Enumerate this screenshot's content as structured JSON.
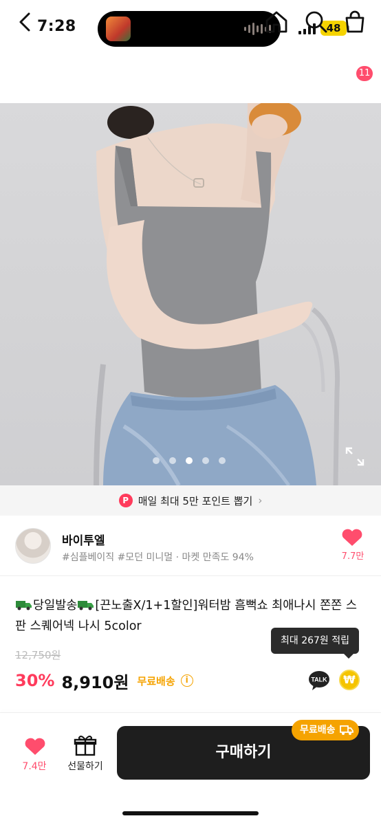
{
  "status_bar": {
    "time": "7:28",
    "battery": "48"
  },
  "nav": {
    "cart_count": "11"
  },
  "hero": {
    "slide_count": 5,
    "active_slide": 3
  },
  "points_banner": {
    "badge": "P",
    "text": "매일 최대 5만 포인트 뽑기",
    "chevron": "›"
  },
  "seller": {
    "name": "바이투엘",
    "tags": "#심플베이직 #모던 미니멀 · 마켓 만족도 94%",
    "like_count": "7.7만"
  },
  "product": {
    "title_part1": "당일발송",
    "title_part2": "[끈노출X/1+1할인]워터밤 흠뻑쇼 최애나시 쫀쫀 스판 스퀘어넥 나시 5color",
    "tooltip": "최대 267원 적립",
    "original_price": "12,750원",
    "discount": "30%",
    "price": "8,910원",
    "free_shipping": "무료배송",
    "info_icon": "i",
    "talk_label": "TALK",
    "won_symbol": "₩"
  },
  "bottom_bar": {
    "like_count": "7.4만",
    "gift_label": "선물하기",
    "buy_label": "구매하기",
    "ship_pill": "무료배송"
  },
  "colors": {
    "accent": "#ff3b5c",
    "shipping": "#f5a300",
    "buy_button": "#1e1e1e"
  }
}
